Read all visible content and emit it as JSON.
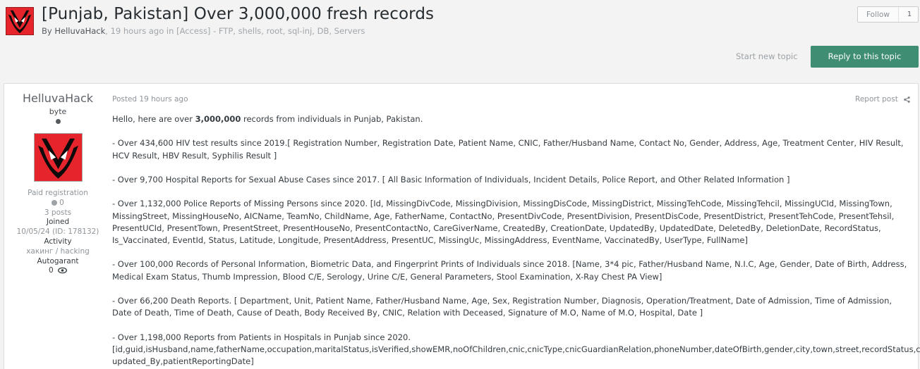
{
  "topic": {
    "title": "[Punjab, Pakistan] Over 3,000,000 fresh records",
    "by_prefix": "By",
    "author": "HelluvaHack",
    "time_text": ", 19 hours ago in",
    "forum": "[Access] - FTP, shells, root, sql-inj, DB, Servers"
  },
  "follow": {
    "label": "Follow",
    "count": "1"
  },
  "actions": {
    "start_topic": "Start new topic",
    "reply": "Reply to this topic"
  },
  "post": {
    "author": {
      "name": "HelluvaHack",
      "title": "byte",
      "group": "Paid registration",
      "reputation": "0",
      "posts": "3 posts",
      "joined_label": "Joined",
      "joined_value": "10/05/24 (ID: 178132)",
      "activity_label": "Activity",
      "activity_value": "хакинг / hacking",
      "autogarant_label": "Autogarant",
      "autogarant_value": "0"
    },
    "posted": "Posted 19 hours ago",
    "report": "Report post",
    "paragraphs": [
      {
        "pre": "Hello, here are over ",
        "bold": "3,000,000",
        "post": " records from individuals in Punjab, Pakistan."
      },
      {
        "pre": "- Over 434,600 HIV test results since 2019.[ Registration Number, Registration Date, Patient Name, CNIC, Father/Husband Name, Contact No, Gender, Address, Age, Treatment Center, HIV Result, HCV Result, HBV Result, Syphilis Result ]"
      },
      {
        "pre": "- Over 9,700 Hospital Reports for Sexual Abuse Cases since 2017. [ All Basic Information of Individuals, Incident Details, Police Report, and Other Related Information ]"
      },
      {
        "pre": "- Over 1,132,000 Police Reports of Missing Persons since 2020. [Id, MissingDivCode, MissingDivision, MissingDisCode, MissingDistrict, MissingTehCode, MissingTehcil, MissingUCId, MissingTown, MissingStreet, MissingHouseNo, AICName, TeamNo, ChildName, Age, FatherName, ContactNo, PresentDivCode, PresentDivision, PresentDisCode, PresentDistrict, PresentTehCode, PresentTehsil, PresentUCId, PresentTown, PresentStreet, PresentHouseNo, PresentContactNo, CareGiverName, CreatedBy, CreationDate, UpdatedBy, UpdatedDate, DeletedBy, DeletionDate, RecordStatus, Is_Vaccinated, EventId, Status, Latitude, Longitude, PresentAddress, PresentUC, MissingUc, MissingAddress, EventName, VaccinatedBy, UserType, FullName]"
      },
      {
        "pre": "- Over 100,000 Records of Personal Information, Biometric Data, and Fingerprint Prints of Individuals since 2018. [Name, 3*4 pic, Father/Husband Name, N.I.C, Age, Gender, Date of Birth, Address, Medical Exam Status, Thumb Impression, Blood C/E, Serology, Urine C/E, General Parameters, Stool Examination, X-Ray Chest PA View]"
      },
      {
        "pre": "- Over 66,200 Death Reports. [ Department, Unit, Patient Name, Father/Husband Name, Age, Sex, Registration Number, Diagnosis, Operation/Treatment, Date of Admission, Time of Admission, Date of Death, Time of Death, Cause of Death, Body Received By, CNIC, Relation with Deceased, Signature of M.O, Name of M.O, Hospital, Date ]"
      },
      {
        "pre": "- Over 1,198,000 Reports from Patients in Hospitals in Punjab since 2020.",
        "line2": "[id,guid,isHusband,name,fatherName,occupation,maritalStatus,isVerified,showEMR,noOfChildren,cnic,cnicType,cnicGuardianRelation,phoneNumber,dateOfBirth,gender,city,town,street,recordStatus,created_By, updated_By,patientReportingDate]"
      }
    ]
  },
  "colors": {
    "accent": "#3f8d72",
    "avatar_red": "#e6242b"
  },
  "icons": {
    "share": "share-icon",
    "eye": "eye-icon",
    "avatar": "avatar"
  }
}
